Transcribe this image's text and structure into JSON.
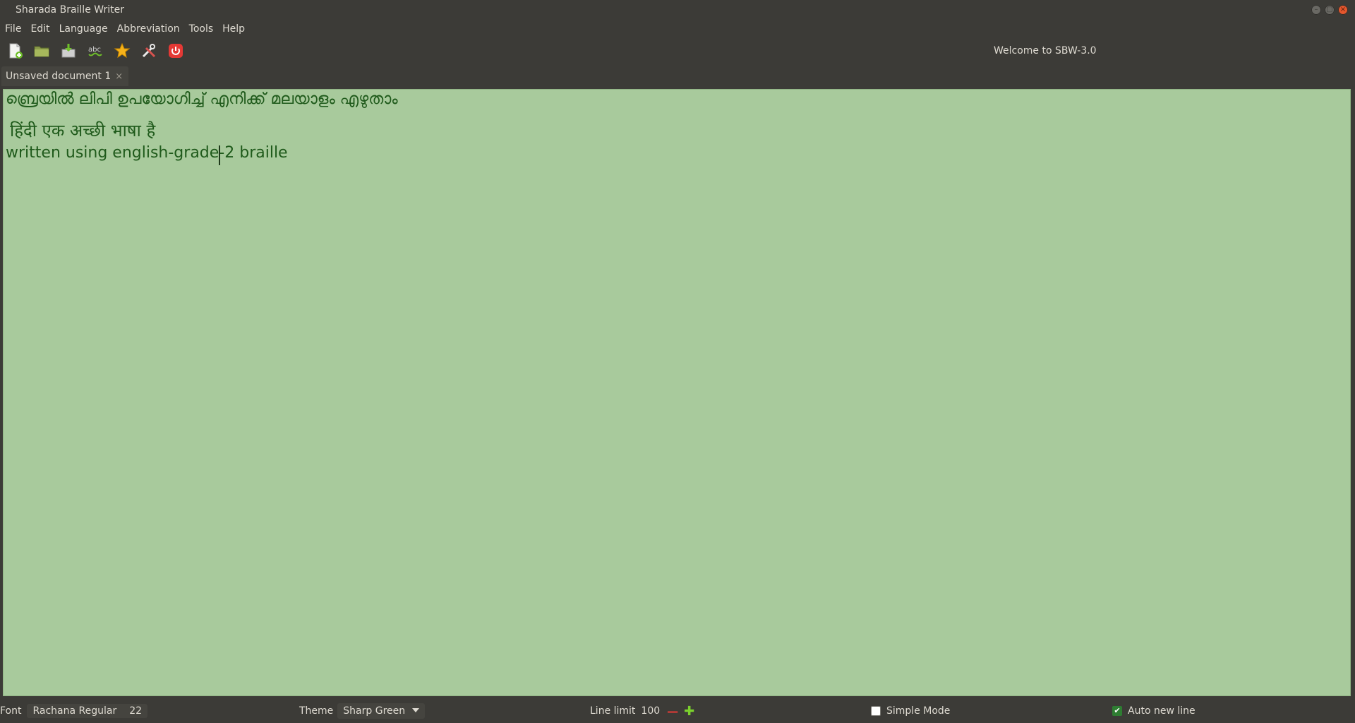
{
  "window": {
    "title": "Sharada Braille Writer"
  },
  "menu": {
    "items": [
      "File",
      "Edit",
      "Language",
      "Abbreviation",
      "Tools",
      "Help"
    ]
  },
  "toolbar": {
    "buttons": [
      {
        "name": "new-document",
        "icon": "new-document-icon"
      },
      {
        "name": "open",
        "icon": "folder-icon"
      },
      {
        "name": "save",
        "icon": "save-icon"
      },
      {
        "name": "spell-check",
        "icon": "spellcheck-icon"
      },
      {
        "name": "favourite",
        "icon": "star-icon"
      },
      {
        "name": "preferences",
        "icon": "tools-icon"
      },
      {
        "name": "quit",
        "icon": "power-icon"
      }
    ],
    "welcome_text": "Welcome to SBW-3.0"
  },
  "tabs": [
    {
      "label": "Unsaved document 1"
    }
  ],
  "editor": {
    "lines": [
      "ബ്രെയിൽ ലിപി ഉപയോഗിച്ച് എനിക്ക് മലയാളം എഴുതാം",
      "हिंदी एक अच्छी भाषा है",
      "written using english-grade-2 braille"
    ],
    "background": "#a8ca9c",
    "text_color": "#1f5a1b"
  },
  "status": {
    "font_label": "Font",
    "font_name": "Rachana Regular",
    "font_size": "22",
    "theme_label": "Theme",
    "theme_value": "Sharp Green",
    "line_limit_label": "Line limit",
    "line_limit_value": "100",
    "simple_mode_label": "Simple Mode",
    "simple_mode_checked": false,
    "auto_new_line_label": "Auto new line",
    "auto_new_line_checked": true
  }
}
